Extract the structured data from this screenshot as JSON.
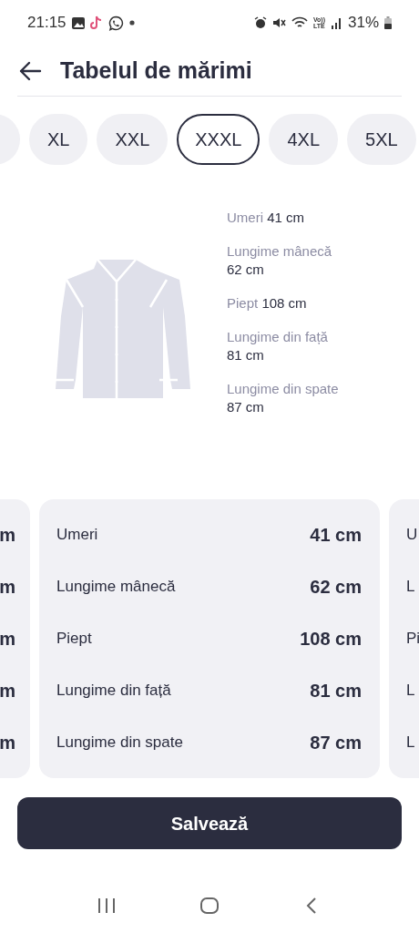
{
  "status_bar": {
    "time": "21:15",
    "network_top": "Vo))",
    "network_bottom": "LTE",
    "battery": "31%"
  },
  "header": {
    "title": "Tabelul de mărimi"
  },
  "sizes": [
    {
      "label": "XL",
      "selected": false
    },
    {
      "label": "XXL",
      "selected": false
    },
    {
      "label": "XXXL",
      "selected": true
    },
    {
      "label": "4XL",
      "selected": false
    },
    {
      "label": "5XL",
      "selected": false
    }
  ],
  "diagram_measurements": [
    {
      "kind": "inline",
      "label": "Umeri",
      "value": "41 cm"
    },
    {
      "kind": "stacked",
      "label": "Lungime mânecă",
      "value": "62 cm"
    },
    {
      "kind": "inline",
      "label": "Piept",
      "value": "108 cm"
    },
    {
      "kind": "stacked",
      "label": "Lungime din față",
      "value": "81 cm"
    },
    {
      "kind": "stacked",
      "label": "Lungime din spate",
      "value": "87 cm"
    }
  ],
  "cards": [
    {
      "kind": "partial_left",
      "rows": [
        {
          "value": "m"
        },
        {
          "value": "m"
        },
        {
          "value": "m"
        },
        {
          "value": "m"
        },
        {
          "value": "m"
        }
      ]
    },
    {
      "kind": "full",
      "rows": [
        {
          "label": "Umeri",
          "value": "41 cm"
        },
        {
          "label": "Lungime mânecă",
          "value": "62 cm"
        },
        {
          "label": "Piept",
          "value": "108 cm"
        },
        {
          "label": "Lungime din față",
          "value": "81 cm"
        },
        {
          "label": "Lungime din spate",
          "value": "87 cm"
        }
      ]
    },
    {
      "kind": "partial_right",
      "rows": [
        {
          "label": "U"
        },
        {
          "label": "L"
        },
        {
          "label": "Pi"
        },
        {
          "label": "L"
        },
        {
          "label": "L"
        }
      ]
    }
  ],
  "save_button": {
    "label": "Salvează"
  }
}
